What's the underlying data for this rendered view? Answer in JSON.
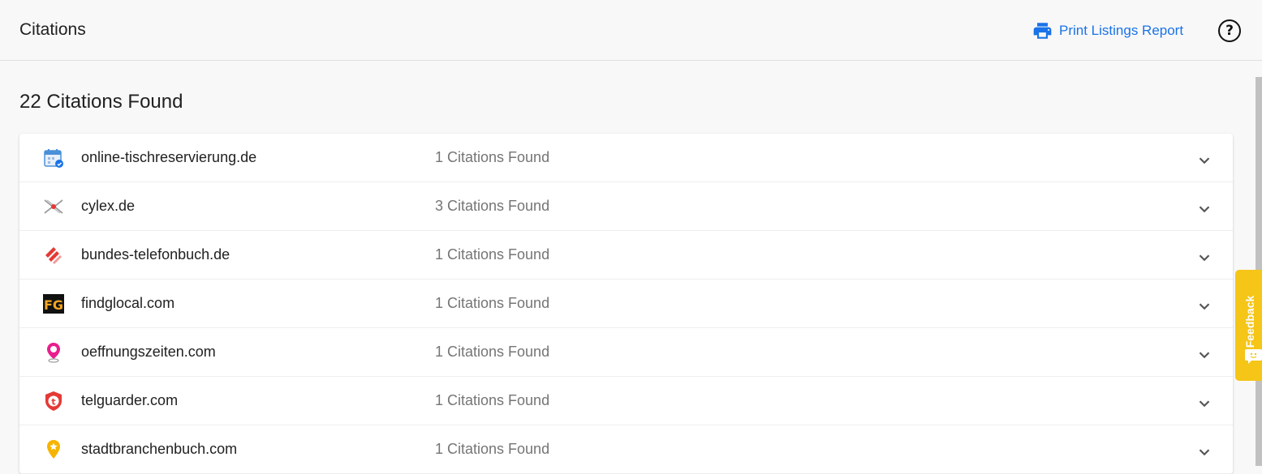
{
  "header": {
    "title": "Citations",
    "print_label": "Print Listings Report",
    "print_icon": "printer-icon",
    "help_icon": "help-circle-icon",
    "help_glyph": "?"
  },
  "main": {
    "heading": "22 Citations Found",
    "rows": [
      {
        "site": "online-tischreservierung.de",
        "count": "1 Citations Found",
        "logo": "calendar-icon"
      },
      {
        "site": "cylex.de",
        "count": "3 Citations Found",
        "logo": "cylex-logo"
      },
      {
        "site": "bundes-telefonbuch.de",
        "count": "1 Citations Found",
        "logo": "stripes-logo"
      },
      {
        "site": "findglocal.com",
        "count": "1 Citations Found",
        "logo": "fg-logo"
      },
      {
        "site": "oeffnungszeiten.com",
        "count": "1 Citations Found",
        "logo": "map-pin-icon"
      },
      {
        "site": "telguarder.com",
        "count": "1 Citations Found",
        "logo": "shield-t-logo"
      },
      {
        "site": "stadtbranchenbuch.com",
        "count": "1 Citations Found",
        "logo": "star-pin-icon"
      }
    ]
  },
  "feedback": {
    "label": "Feedback",
    "icon": "chat-icon"
  },
  "colors": {
    "accent": "#1a73e8",
    "feedback_bg": "#f5c518",
    "muted_text": "#757575"
  }
}
